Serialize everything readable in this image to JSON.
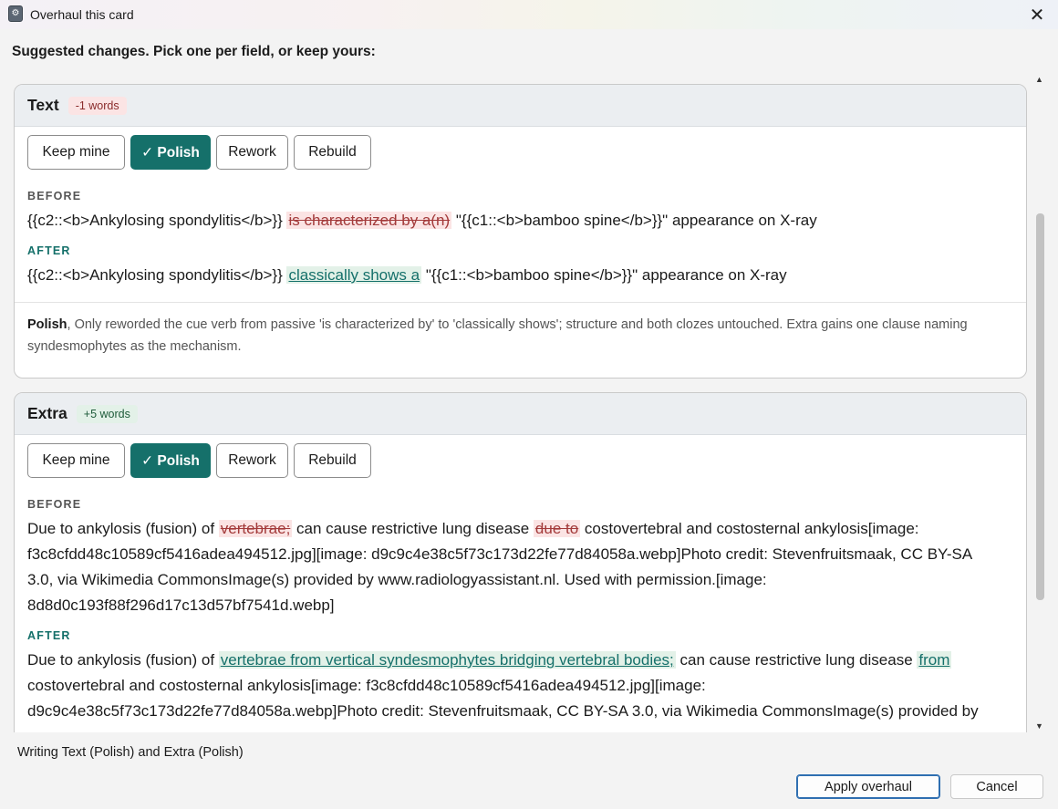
{
  "window": {
    "title": "Overhaul this card",
    "close_icon": "✕"
  },
  "heading": "Suggested changes. Pick one per field, or keep yours:",
  "fields": [
    {
      "name": "Text",
      "delta": "-1 words",
      "choices": [
        "Keep mine",
        "✓ Polish",
        "Rework",
        "Rebuild"
      ],
      "selected": "✓ Polish",
      "before_label": "BEFORE",
      "after_label": "AFTER",
      "before": {
        "pre": "{{c2::<b>Ankylosing spondylitis</b>}} ",
        "del": "is characterized by a(n)",
        "post": " \"{{c1::<b>bamboo spine</b>}}\" appearance on X-ray"
      },
      "after": {
        "pre": "{{c2::<b>Ankylosing spondylitis</b>}} ",
        "ins": "classically shows a",
        "post": " \"{{c1::<b>bamboo spine</b>}}\" appearance on X-ray"
      },
      "explain_title": "Polish",
      "explain_text": ", Only reworded the cue verb from passive 'is characterized by' to 'classically shows'; structure and both clozes untouched. Extra gains one clause naming syndesmophytes as the mechanism."
    },
    {
      "name": "Extra",
      "delta": "+5 words",
      "choices": [
        "Keep mine",
        "✓ Polish",
        "Rework",
        "Rebuild"
      ],
      "selected": "✓ Polish",
      "before_label": "BEFORE",
      "after_label": "AFTER",
      "before": {
        "p1": "Due to ankylosis (fusion) of ",
        "del1": "vertebrae;",
        "p2": " can cause restrictive lung disease ",
        "del2": "due to",
        "p3": " costovertebral and costosternal ankylosis[image:",
        "l2": "f3c8cfdd48c10589cf5416adea494512.jpg][image: d9c9c4e38c5f73c173d22fe77d84058a.webp]Photo credit: Stevenfruitsmaak, CC BY-SA",
        "l3": "3.0, via Wikimedia CommonsImage(s) provided by www.radiologyassistant.nl. Used with permission.[image:",
        "l4": "8d8d0c193f88f296d17c13d57bf7541d.webp]"
      },
      "after": {
        "p1": "Due to ankylosis (fusion) of ",
        "ins1": "vertebrae from vertical syndesmophytes bridging vertebral bodies;",
        "p2": " can cause restrictive lung disease ",
        "ins2": "from",
        "l2": "costovertebral and costosternal ankylosis[image: f3c8cfdd48c10589cf5416adea494512.jpg][image:",
        "l3": "d9c9c4e38c5f73c173d22fe77d84058a.webp]Photo credit: Stevenfruitsmaak, CC BY-SA 3.0, via Wikimedia CommonsImage(s) provided by"
      }
    }
  ],
  "status": "Writing Text (Polish) and Extra (Polish)",
  "buttons": {
    "apply": "Apply overhaul",
    "cancel": "Cancel"
  },
  "scrollbar": {
    "up_icon": "▲",
    "down_icon": "▼"
  }
}
